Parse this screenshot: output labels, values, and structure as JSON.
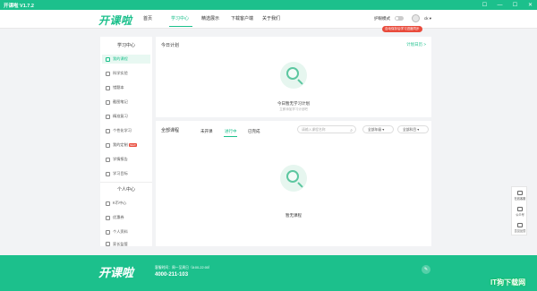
{
  "window": {
    "title": "开课啦 V1.7.2",
    "controls": [
      "☐",
      "—",
      "☐",
      "✕"
    ]
  },
  "header": {
    "logo_text": "开课啦",
    "nav": [
      "首页",
      "学习中心",
      "精选展示",
      "下载客户端",
      "关于我们"
    ],
    "active_nav": "学习中心",
    "eye_mode_label": "护眼模式",
    "username": "ck ▾",
    "tooltip": "自动保存后学习进度同步",
    "accent": "#1cc08c"
  },
  "sidebar": {
    "study_heading": "学习中心",
    "study_items": [
      {
        "label": "我的课程",
        "active": true,
        "badge": ""
      },
      {
        "label": "科学实验",
        "active": false,
        "badge": ""
      },
      {
        "label": "错题本",
        "active": false,
        "badge": ""
      },
      {
        "label": "截图笔记",
        "active": false,
        "badge": ""
      },
      {
        "label": "精准复习",
        "active": false,
        "badge": ""
      },
      {
        "label": "个性化学习",
        "active": false,
        "badge": ""
      },
      {
        "label": "我的定制",
        "active": false,
        "badge": "NEW"
      },
      {
        "label": "学情报告",
        "active": false,
        "badge": ""
      },
      {
        "label": "学习目标",
        "active": false,
        "badge": ""
      }
    ],
    "personal_heading": "个人中心",
    "personal_items": [
      {
        "label": "K币中心"
      },
      {
        "label": "优惠券"
      },
      {
        "label": "个人资料"
      },
      {
        "label": "家长监管"
      }
    ]
  },
  "today_plan": {
    "title": "今日计划",
    "link": "计划日历 >",
    "empty_text": "今日暂无学习计划",
    "empty_sub": "立即添加学习计划吧"
  },
  "courses": {
    "title": "全部课程",
    "tabs": [
      "未开课",
      "进行中",
      "已完成"
    ],
    "active_tab": "进行中",
    "search_placeholder": "请输入课程名称",
    "select_grade": "全部年级",
    "select_subject": "全部科目",
    "empty_text": "暂无课程"
  },
  "float_bar": {
    "items": [
      "在线客服",
      "公众号",
      "意见反馈"
    ]
  },
  "footer": {
    "logo_text": "开课啦",
    "hours": "客服时间：周一至周日（8:00-22:00）",
    "phone": "4000-211-103",
    "watermark": "IT狗下载网"
  }
}
